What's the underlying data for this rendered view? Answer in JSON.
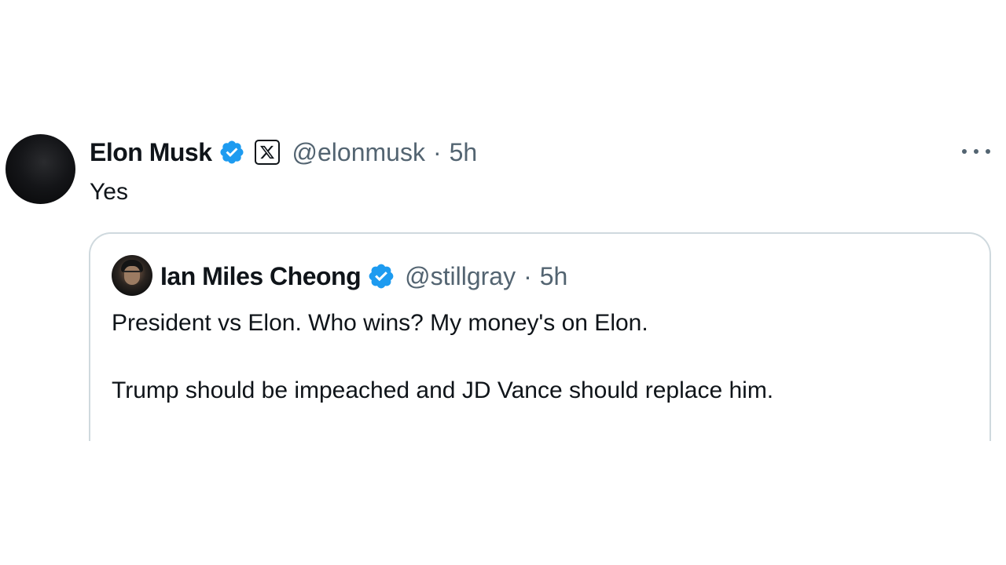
{
  "tweet": {
    "author": {
      "display_name": "Elon Musk",
      "handle": "@elonmusk",
      "verified": true,
      "affiliate_icon": "x-logo-icon"
    },
    "separator": "·",
    "time": "5h",
    "text": "Yes",
    "more_icon": "more-horizontal-icon"
  },
  "quote": {
    "author": {
      "display_name": "Ian Miles Cheong",
      "handle": "@stillgray",
      "verified": true
    },
    "separator": "·",
    "time": "5h",
    "paragraphs": [
      "President vs Elon. Who wins? My money's on Elon.",
      "Trump should be impeached and JD Vance should replace him."
    ]
  },
  "colors": {
    "text_primary": "#0f1419",
    "text_secondary": "#536471",
    "verified_blue": "#1d9bf0",
    "border": "#cfd9de"
  }
}
